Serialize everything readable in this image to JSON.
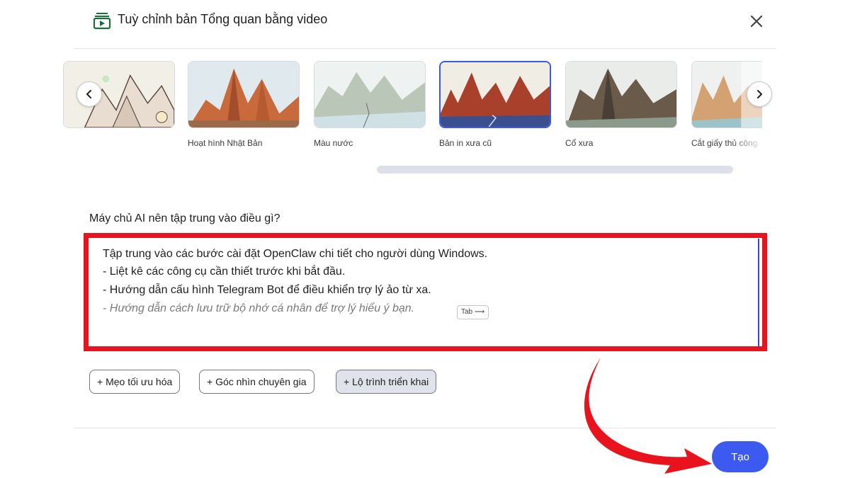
{
  "header": {
    "title": "Tuỳ chỉnh bản Tổng quan bằng video",
    "icon": "video-overview-icon",
    "close_icon": "close-icon"
  },
  "carousel": {
    "styles": [
      {
        "label": "",
        "selected": false
      },
      {
        "label": "Hoạt hình Nhật Bản",
        "selected": false
      },
      {
        "label": "Màu nước",
        "selected": false
      },
      {
        "label": "Bản in xưa cũ",
        "selected": true
      },
      {
        "label": "Cổ xưa",
        "selected": false
      },
      {
        "label": "Cắt giấy thủ công",
        "selected": false
      }
    ],
    "prev_icon": "chevron-left-icon",
    "next_icon": "chevron-right-icon"
  },
  "prompt": {
    "label": "Máy chủ AI nên tập trung vào điều gì?",
    "lines": [
      "Tập trung vào các bước cài đặt OpenClaw chi tiết cho người dùng Windows.",
      "- Liệt kê các công cụ cần thiết trước khi bắt đầu.",
      "- Hướng dẫn cấu hình Telegram Bot để điều khiển trợ lý ảo từ xa."
    ],
    "suggestion": "- Hướng dẫn cách lưu trữ bộ nhớ cá nhân để trợ lý hiểu ý bạn.",
    "tab_hint": "Tab ⟶"
  },
  "chips": [
    {
      "label": "+ Mẹo tối ưu hóa",
      "active": false
    },
    {
      "label": "+ Góc nhìn chuyên gia",
      "active": false
    },
    {
      "label": "+ Lộ trình triển khai",
      "active": true
    }
  ],
  "actions": {
    "create_label": "Tạo"
  },
  "colors": {
    "accent": "#3c5af0",
    "highlight_red": "#e8131c",
    "selected_border": "#3b5bdb"
  }
}
